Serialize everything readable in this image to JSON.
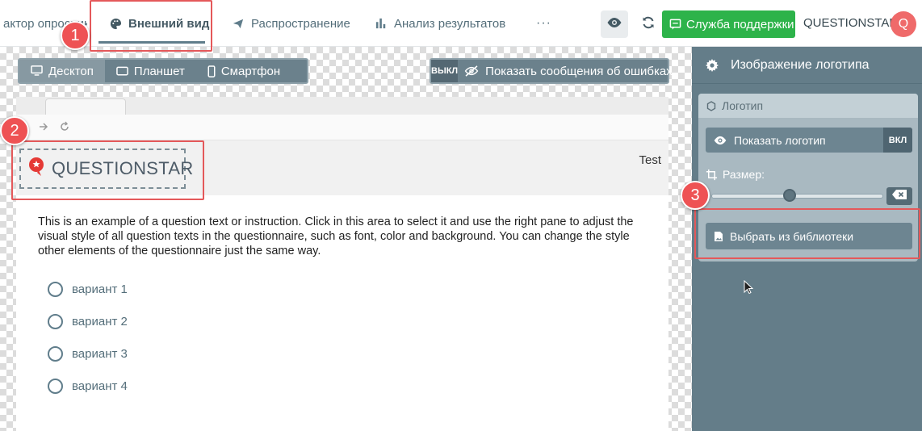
{
  "topbar": {
    "tabs": [
      {
        "label": "актор опросника",
        "icon": "none"
      },
      {
        "label": "Внешний вид",
        "icon": "palette-icon",
        "active": true
      },
      {
        "label": "Распространение",
        "icon": "send-icon"
      },
      {
        "label": "Анализ результатов",
        "icon": "bar-chart-icon"
      }
    ],
    "more_label": "···",
    "support_label": "Служба поддержки",
    "brand": "QUESTIONSTAR",
    "avatar_initial": "Q"
  },
  "canvas": {
    "devices": [
      {
        "label": "Десктоп",
        "icon": "desktop-icon",
        "active": true
      },
      {
        "label": "Планшет",
        "icon": "tablet-icon"
      },
      {
        "label": "Смартфон",
        "icon": "smartphone-icon"
      }
    ],
    "errors_toggle": {
      "state": "ВЫКЛ",
      "label": "Показать сообщения об ошибках"
    },
    "survey": {
      "logo_text": "QUESTIONSTAR",
      "header_right": "Test",
      "question_text": "This is an example of a question text or instruction. Click in this area to select it and use the right pane to adjust the visual style of all question texts in the questionnaire, such as font, color and background. You can change the style other elements of the questionnaire just the same way.",
      "options": [
        "вариант 1",
        "вариант 2",
        "вариант 3",
        "вариант 4"
      ]
    }
  },
  "panel": {
    "title": "Изображение логотипа",
    "section_title": "Логотип",
    "show_logo_label": "Показать логотип",
    "show_logo_state": "ВКЛ",
    "size_label": "Размер:",
    "size_value": 0.45,
    "choose_label": "Выбрать из библиотеки"
  },
  "markers": [
    "1",
    "2",
    "3"
  ],
  "colors": {
    "accent_red": "#e4585a",
    "support_green": "#2db34a",
    "panel_bg": "#647d89"
  }
}
